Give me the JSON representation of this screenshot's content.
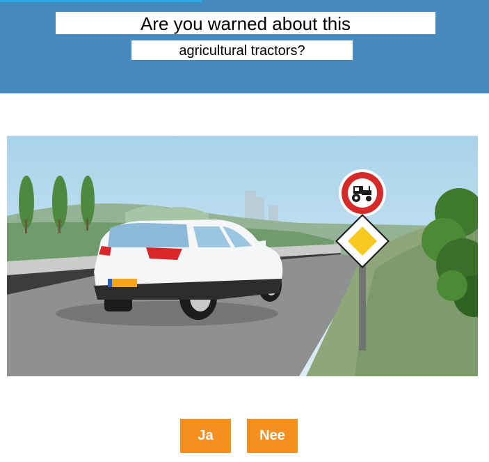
{
  "question": {
    "line1": "Are you warned about this",
    "line2": "agricultural tractors?"
  },
  "scene": {
    "sign_icon": "no-tractors-sign-icon",
    "priority_road_icon": "priority-road-sign-icon"
  },
  "answers": {
    "yes_label": "Ja",
    "no_label": "Nee"
  },
  "colors": {
    "header": "#4589be",
    "accent": "#2da9e6",
    "button": "#f5901e"
  }
}
